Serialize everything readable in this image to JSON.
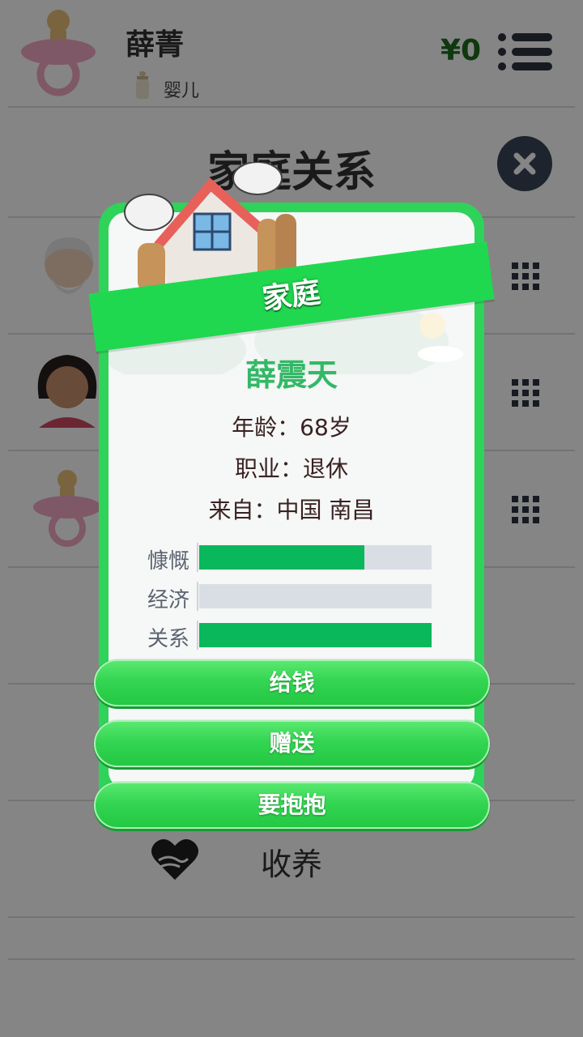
{
  "header": {
    "player_name": "薛菁",
    "life_stage": "婴儿",
    "money": "¥0"
  },
  "page": {
    "title": "家庭关系",
    "adopt_label": "收养"
  },
  "modal": {
    "ribbon_title": "家庭",
    "member": {
      "name": "薛震天",
      "age_line": "年龄：68岁",
      "job_line": "职业：退休",
      "from_line": "来自：中国 南昌"
    },
    "stats": [
      {
        "label": "慷慨",
        "value": 0.71
      },
      {
        "label": "经济",
        "value": 0.0
      },
      {
        "label": "关系",
        "value": 1.0
      }
    ],
    "actions": [
      {
        "label": "给钱"
      },
      {
        "label": "赠送"
      },
      {
        "label": "要抱抱"
      }
    ]
  },
  "colors": {
    "accent_green": "#2fd35a",
    "stat_fill": "#08b85a",
    "name_green": "#34b867",
    "overlay": "rgba(0,0,0,0.48)"
  }
}
